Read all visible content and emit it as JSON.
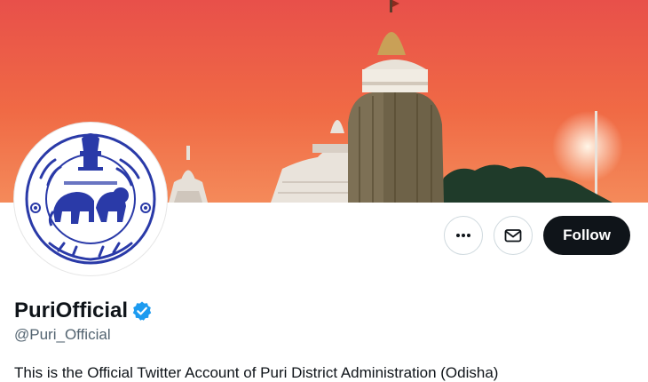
{
  "profile": {
    "display_name": "PuriOfficial",
    "handle": "@Puri_Official",
    "bio": "This is the Official Twitter Account of Puri District Administration (Odisha)",
    "verified": true
  },
  "actions": {
    "follow_label": "Follow",
    "more_icon": "more-horizontal-icon",
    "message_icon": "envelope-icon"
  },
  "colors": {
    "verified_blue": "#1d9bf0",
    "follow_bg": "#0f1419",
    "banner_sky": "#f05a3c",
    "emblem_blue": "#2a3aa8"
  }
}
